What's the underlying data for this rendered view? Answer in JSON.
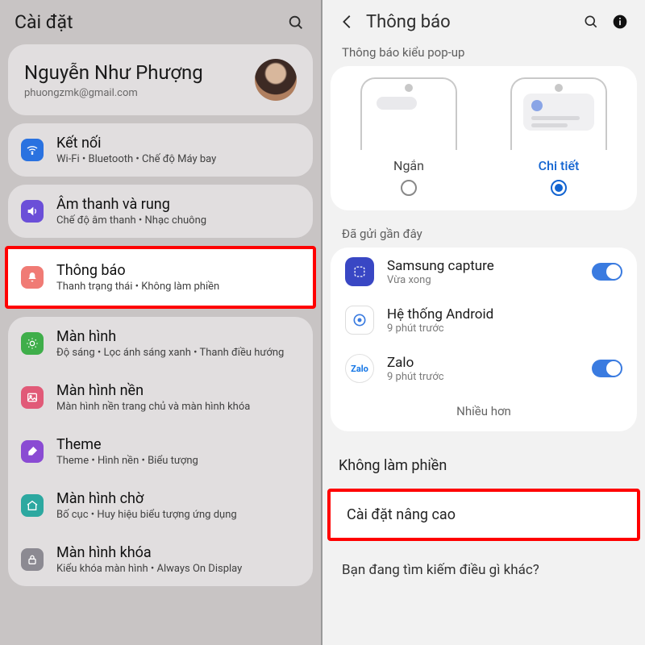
{
  "left": {
    "header": {
      "title": "Cài đặt"
    },
    "profile": {
      "name": "Nguyễn Như Phượng",
      "email": "phuongzmk@gmail.com"
    },
    "groups": [
      [
        {
          "id": "connections",
          "title": "Kết nối",
          "sub": "Wi-Fi • Bluetooth • Chế độ Máy bay",
          "color": "ic-blue",
          "glyph": "wifi"
        }
      ],
      [
        {
          "id": "sound",
          "title": "Âm thanh và rung",
          "sub": "Chế độ âm thanh • Nhạc chuông",
          "color": "ic-purple",
          "glyph": "speaker"
        }
      ],
      [
        {
          "id": "notifications",
          "title": "Thông báo",
          "sub": "Thanh trạng thái • Không làm phiền",
          "color": "ic-coral",
          "glyph": "bell",
          "highlight": true
        }
      ],
      [
        {
          "id": "display",
          "title": "Màn hình",
          "sub": "Độ sáng • Lọc ánh sáng xanh • Thanh điều hướng",
          "color": "ic-green",
          "glyph": "sun"
        },
        {
          "id": "wallpaper",
          "title": "Màn hình nền",
          "sub": "Màn hình nền trang chủ và màn hình khóa",
          "color": "ic-pink",
          "glyph": "image"
        },
        {
          "id": "theme",
          "title": "Theme",
          "sub": "Theme • Hình nền • Biểu tượng",
          "color": "ic-violet",
          "glyph": "brush"
        },
        {
          "id": "homescreen",
          "title": "Màn hình chờ",
          "sub": "Bố cục • Huy hiệu biểu tượng ứng dụng",
          "color": "ic-teal",
          "glyph": "home"
        },
        {
          "id": "lockscreen",
          "title": "Màn hình khóa",
          "sub": "Kiểu khóa màn hình • Always On Display",
          "color": "ic-grey",
          "glyph": "lock"
        }
      ]
    ]
  },
  "right": {
    "header": {
      "title": "Thông báo"
    },
    "popup": {
      "section_label": "Thông báo kiểu pop-up",
      "options": [
        {
          "id": "brief",
          "label": "Ngắn",
          "active": false
        },
        {
          "id": "detail",
          "label": "Chi tiết",
          "active": true
        }
      ]
    },
    "recent": {
      "section_label": "Đã gửi gần đây",
      "apps": [
        {
          "id": "samsung-capture",
          "name": "Samsung capture",
          "sub": "Vừa xong",
          "icon": "samsung",
          "toggle": true
        },
        {
          "id": "android-system",
          "name": "Hệ thống Android",
          "sub": "9 phút trước",
          "icon": "android",
          "toggle": null
        },
        {
          "id": "zalo",
          "name": "Zalo",
          "sub": "9 phút trước",
          "icon": "zalo",
          "toggle": true
        }
      ],
      "more_label": "Nhiều hơn"
    },
    "plain_items": [
      {
        "id": "do-not-disturb",
        "label": "Không làm phiền",
        "highlight": false
      },
      {
        "id": "advanced-settings",
        "label": "Cài đặt nâng cao",
        "highlight": true
      }
    ],
    "footer_question": "Bạn đang tìm kiếm điều gì khác?"
  }
}
